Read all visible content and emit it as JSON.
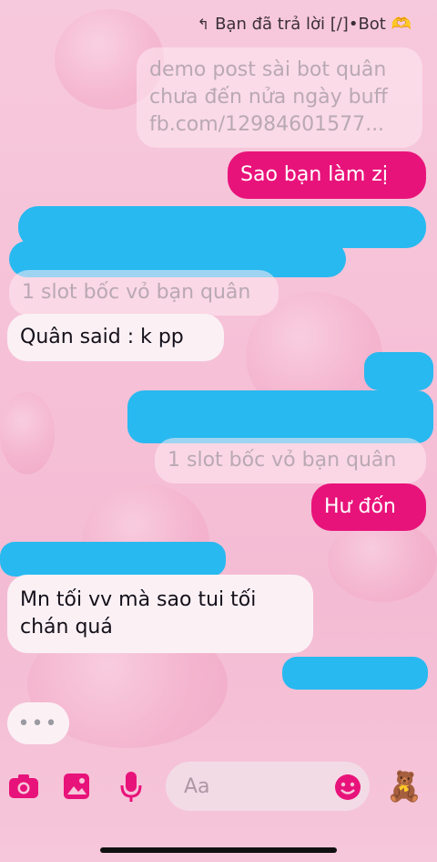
{
  "reply_header": {
    "text": "Bạn đã trả lời [/]•Bot 🫶"
  },
  "messages": [
    {
      "type": "quote",
      "lines": [
        "demo post sài bot quân",
        "chưa đến nửa ngày buff",
        "fb.com/12984601577..."
      ]
    },
    {
      "type": "sent",
      "text": "Sao bạn làm zị"
    },
    {
      "type": "quote",
      "text": "1 slot bốc vỏ bạn quân"
    },
    {
      "type": "received",
      "text": "Quân said : k pp"
    },
    {
      "type": "quote",
      "text": "1 slot bốc vỏ bạn quân"
    },
    {
      "type": "sent",
      "text": "Hư đốn"
    },
    {
      "type": "received",
      "lines": [
        "Mn tối vv mà sao tui tối",
        "chán quá"
      ]
    }
  ],
  "typing_indicator": "•••",
  "composer": {
    "placeholder": "Aa",
    "camera_icon": "camera-icon",
    "gallery_icon": "gallery-icon",
    "mic_icon": "microphone-icon",
    "emoji_icon": "emoji-icon",
    "quick_reaction": "🧸"
  },
  "colors": {
    "accent": "#e8137a",
    "scribble": "#28b9f0"
  }
}
